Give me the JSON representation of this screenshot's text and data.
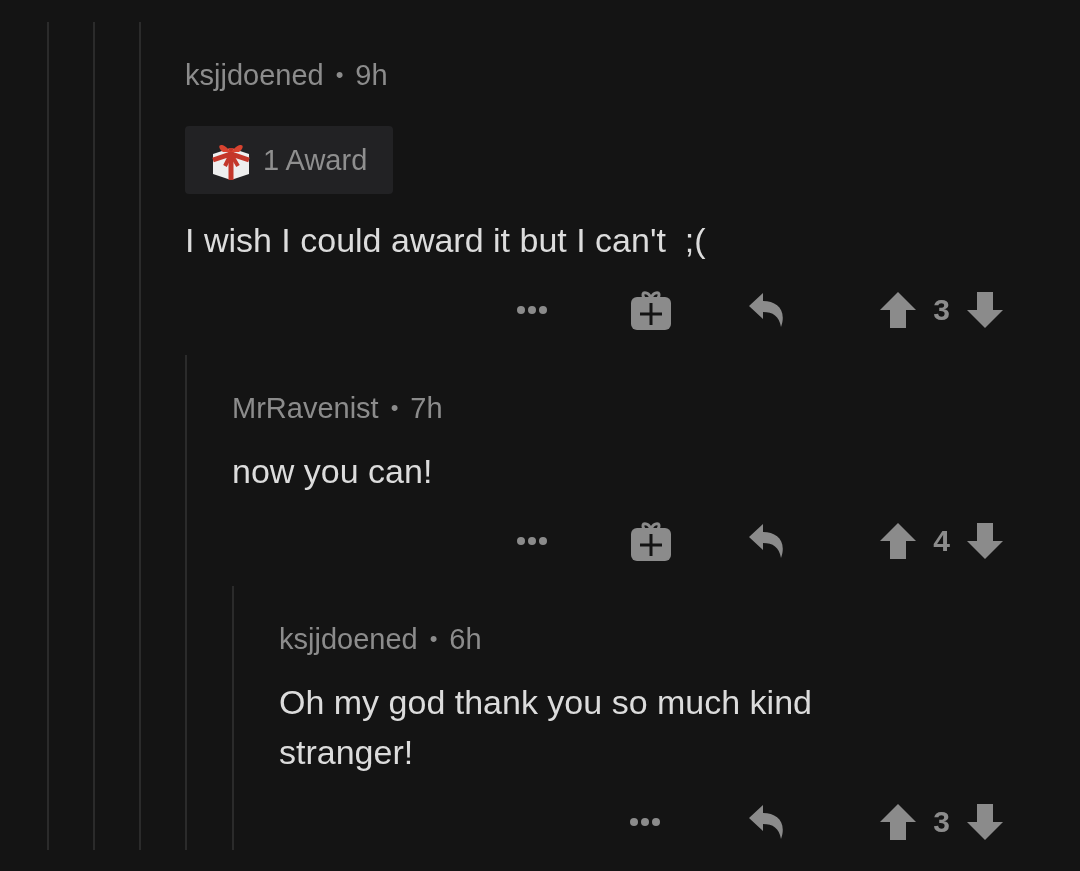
{
  "comments": [
    {
      "author": "ksjjdoened",
      "separator": "•",
      "age": "9h",
      "award": {
        "label": "1 Award"
      },
      "body": "I wish I could award it but I can't  ;(",
      "can_gift": true,
      "score": "3",
      "replies": [
        {
          "author": "MrRavenist",
          "separator": "•",
          "age": "7h",
          "body": "now you can!",
          "can_gift": true,
          "score": "4",
          "replies": [
            {
              "author": "ksjjdoened",
              "separator": "•",
              "age": "6h",
              "body": "Oh my god thank you so much kind stranger!",
              "can_gift": false,
              "score": "3"
            }
          ]
        }
      ]
    }
  ]
}
